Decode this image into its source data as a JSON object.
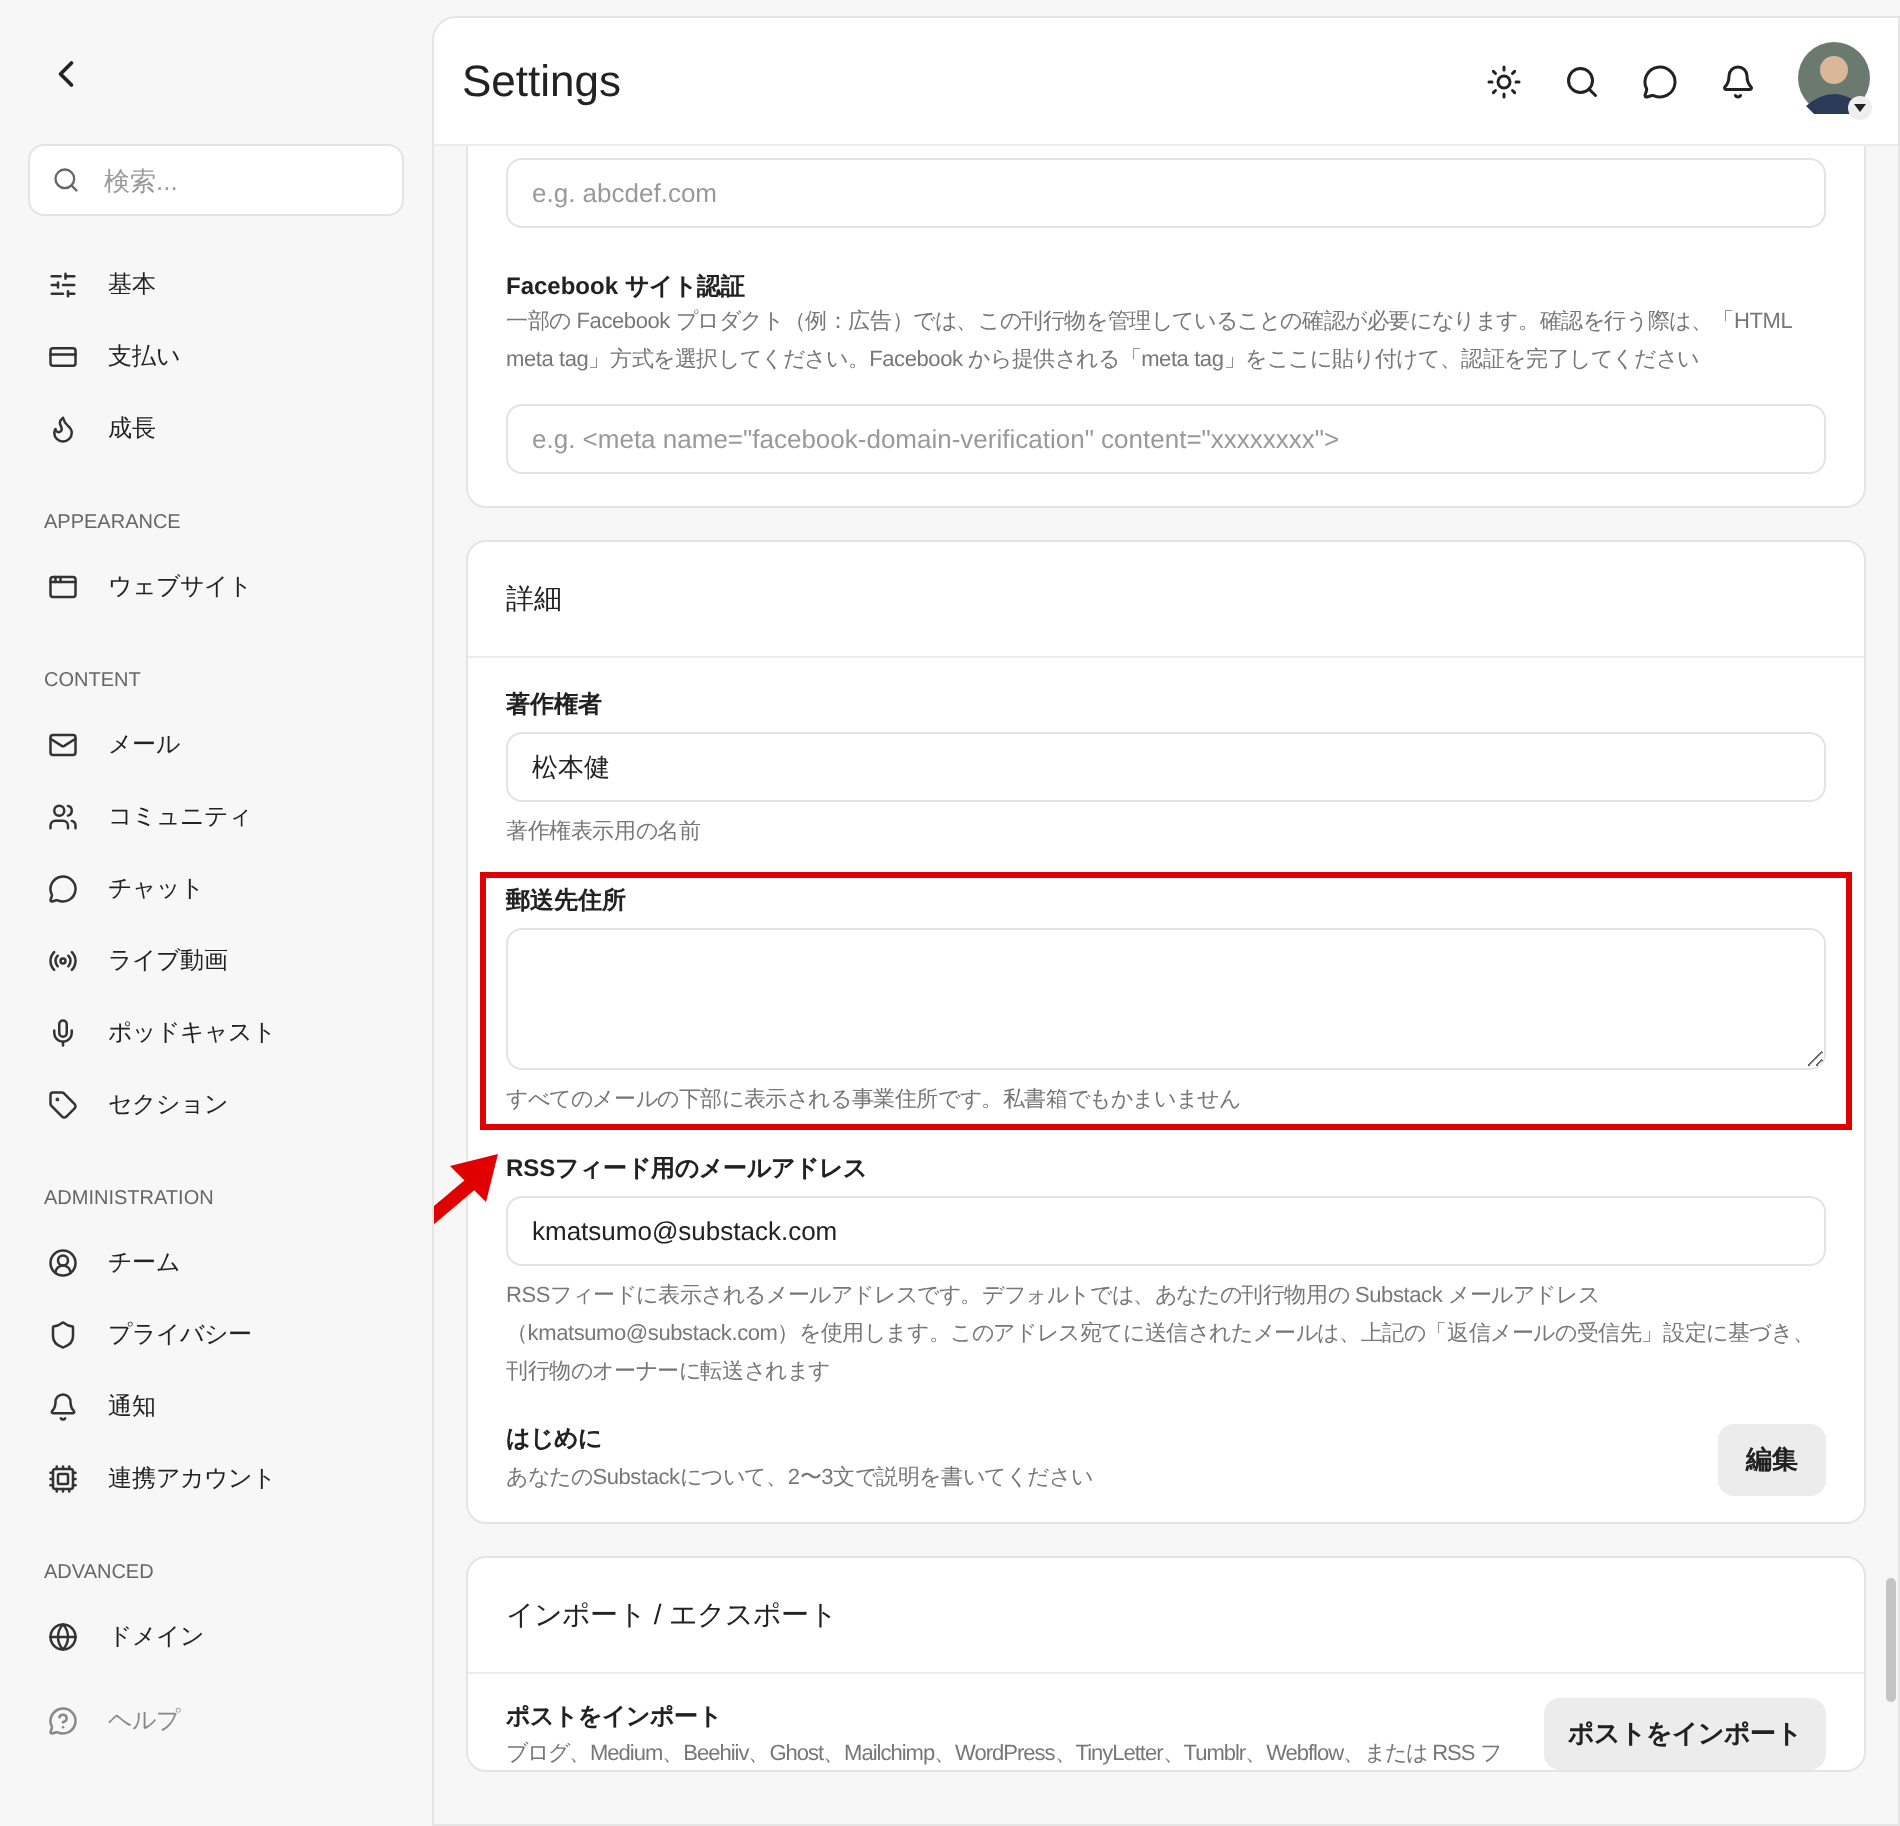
{
  "sidebar": {
    "search": {
      "placeholder": "検索..."
    },
    "groups": [
      {
        "items": [
          {
            "label": "基本"
          },
          {
            "label": "支払い"
          },
          {
            "label": "成長"
          }
        ]
      },
      {
        "heading": "APPEARANCE",
        "items": [
          {
            "label": "ウェブサイト"
          }
        ]
      },
      {
        "heading": "CONTENT",
        "items": [
          {
            "label": "メール"
          },
          {
            "label": "コミュニティ"
          },
          {
            "label": "チャット"
          },
          {
            "label": "ライブ動画"
          },
          {
            "label": "ポッドキャスト"
          },
          {
            "label": "セクション"
          }
        ]
      },
      {
        "heading": "ADMINISTRATION",
        "items": [
          {
            "label": "チーム"
          },
          {
            "label": "プライバシー"
          },
          {
            "label": "通知"
          },
          {
            "label": "連携アカウント"
          }
        ]
      },
      {
        "heading": "ADVANCED",
        "items": [
          {
            "label": "ドメイン"
          }
        ]
      }
    ],
    "help": {
      "label": "ヘルプ",
      "disabled": true
    }
  },
  "header": {
    "title": "Settings"
  },
  "top_card": {
    "fields": [
      {
        "placeholder": "e.g. abcdef.com"
      },
      {
        "label": "Facebook サイト認証",
        "description": "一部の Facebook プロダクト（例：広告）では、この刊行物を管理していることの確認が必要になります。確認を行う際は、「HTML meta tag」方式を選択してください。Facebook から提供される「meta tag」をここに貼り付けて、認証を完了してください",
        "placeholder": "e.g. <meta name=\"facebook-domain-verification\" content=\"xxxxxxxx\">"
      }
    ]
  },
  "details_card": {
    "title": "詳細",
    "fields": [
      {
        "kind": "input",
        "label": "著作権者",
        "value": "松本健",
        "hint": "著作権表示用の名前"
      },
      {
        "kind": "textarea",
        "label": "郵送先住所",
        "hint": "すべてのメールの下部に表示される事業住所です。私書箱でもかまいません",
        "highlighted": true
      },
      {
        "kind": "input",
        "label": "RSSフィード用のメールアドレス",
        "value": "kmatsumo@substack.com",
        "hint": "RSSフィードに表示されるメールアドレスです。デフォルトでは、あなたの刊行物用の Substack メールアドレス（kmatsumo@substack.com）を使用します。このアドレス宛てに送信されたメールは、上記の「返信メールの受信先」設定に基づき、刊行物のオーナーに転送されます",
        "arrow": true
      },
      {
        "kind": "action",
        "label": "はじめに",
        "hint": "あなたのSubstackについて、2〜3文で説明を書いてください",
        "button": "編集"
      }
    ]
  },
  "import_card": {
    "title": "インポート / エクスポート",
    "rows": [
      {
        "label": "ポストをインポート",
        "description": "ブログ、Medium、Beehiiv、Ghost、Mailchimp、WordPress、TinyLetter、Tumblr、Webflow、または RSS フ",
        "button": "ポストをインポート"
      }
    ]
  }
}
